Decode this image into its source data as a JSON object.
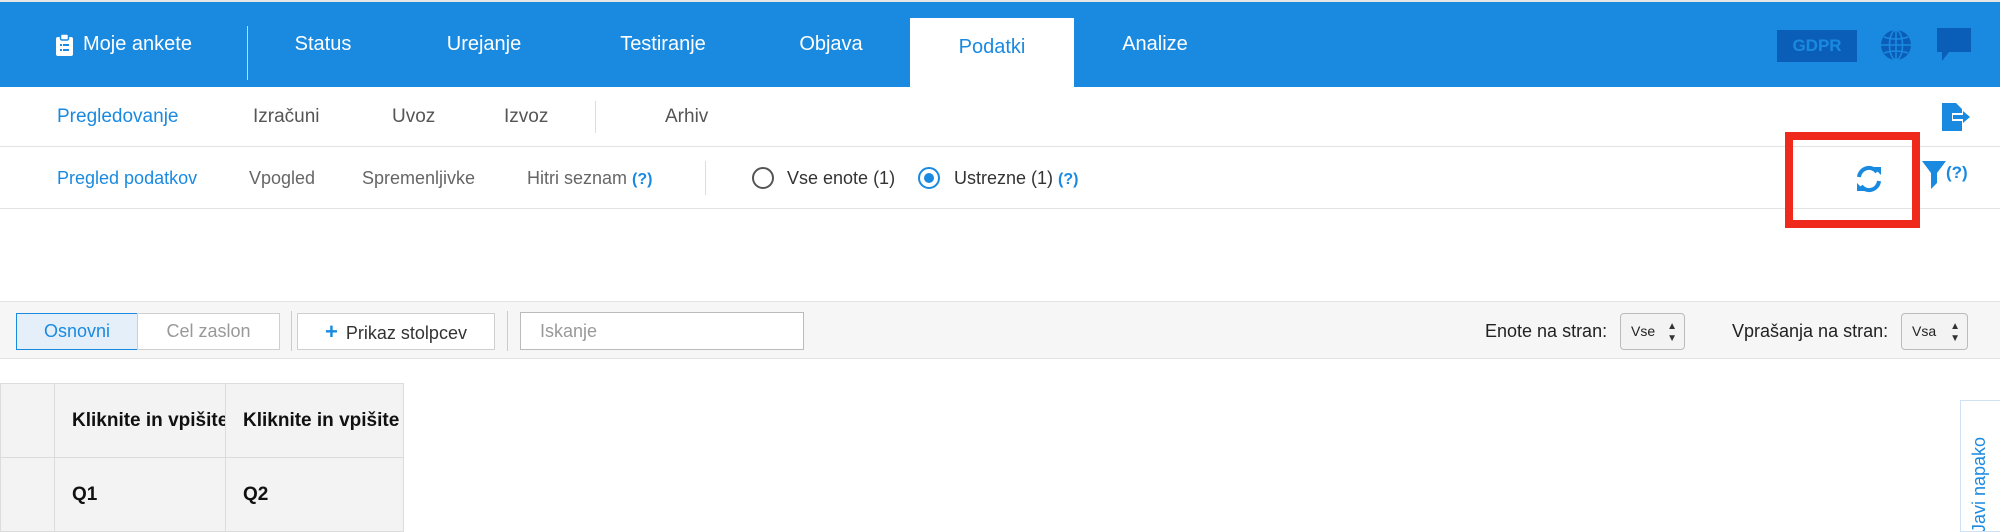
{
  "colors": {
    "brand_blue": "#1a8ae0",
    "highlight_red": "#f0291d"
  },
  "topnav": {
    "home": "Moje ankete",
    "tabs": [
      "Status",
      "Urejanje",
      "Testiranje",
      "Objava",
      "Podatki",
      "Analize"
    ],
    "active_tab": "Podatki",
    "gdpr": "GDPR",
    "icons": [
      "clipboard-icon",
      "globe-icon",
      "chat-icon"
    ]
  },
  "subnav": {
    "items": [
      "Pregledovanje",
      "Izračuni",
      "Uvoz",
      "Izvoz",
      "Arhiv"
    ],
    "active": "Pregledovanje",
    "icon": "export-icon"
  },
  "viewbar": {
    "items": [
      "Pregled podatkov",
      "Vpogled",
      "Spremenljivke",
      "Hitri seznam"
    ],
    "active": "Pregled podatkov",
    "help": "(?)",
    "radio_all": "Vse enote (1)",
    "radio_valid": "Ustrezne (1)",
    "radio_selected": "Ustrezne (1)",
    "icons": [
      "refresh-icon",
      "filter-icon"
    ]
  },
  "toolbar": {
    "basic": "Osnovni",
    "fullscreen": "Cel zaslon",
    "columns": "Prikaz stolpcev",
    "search_placeholder": "Iskanje",
    "units_label": "Enote na stran:",
    "units_value": "Vse",
    "questions_label": "Vprašanja na stran:",
    "questions_value": "Vsa"
  },
  "table": {
    "headers": [
      "Kliknite in vpišite",
      "Kliknite in vpišite"
    ],
    "codes": [
      "Q1",
      "Q2"
    ]
  },
  "sidetab": {
    "label": "Javi napako"
  }
}
